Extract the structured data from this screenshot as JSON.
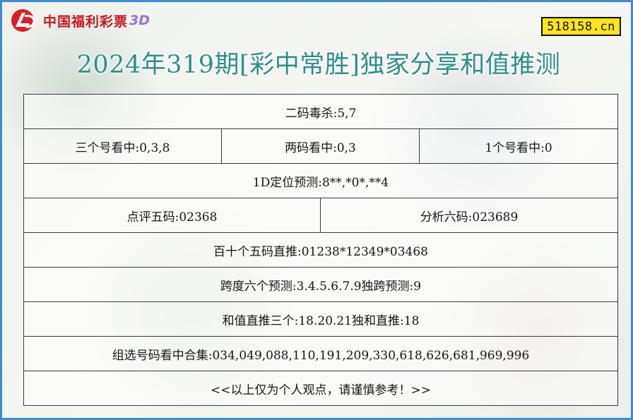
{
  "brand": {
    "logo_text": "中国福利彩票",
    "logo_suffix": "3D",
    "site": "518158.cn"
  },
  "title": "2024年319期[彩中常胜]独家分享和值推测",
  "rows": {
    "r1": "二码毒杀:5,7",
    "r2": [
      "三个号看中:0,3,8",
      "两码看中:0,3",
      "1个号看中:0"
    ],
    "r3": "1D定位预测:8**,*0*,**4",
    "r4": [
      "点评五码:02368",
      "分析六码:023689"
    ],
    "r5": "百十个五码直推:01238*12349*03468",
    "r6": "跨度六个预测:3.4.5.6.7.9独跨预测:9",
    "r7": "和值直推三个:18.20.21独和直推:18",
    "r8": "组选号码看中合集:034,049,088,110,191,209,330,618,626,681,969,996",
    "r9": "<<以上仅为个人观点，请谨慎参考！>>"
  },
  "colors": {
    "frame_border": "#3d8bd0",
    "title": "#2e8f8a",
    "logo_red": "#c7161e",
    "badge_bg": "#ffe41a"
  }
}
